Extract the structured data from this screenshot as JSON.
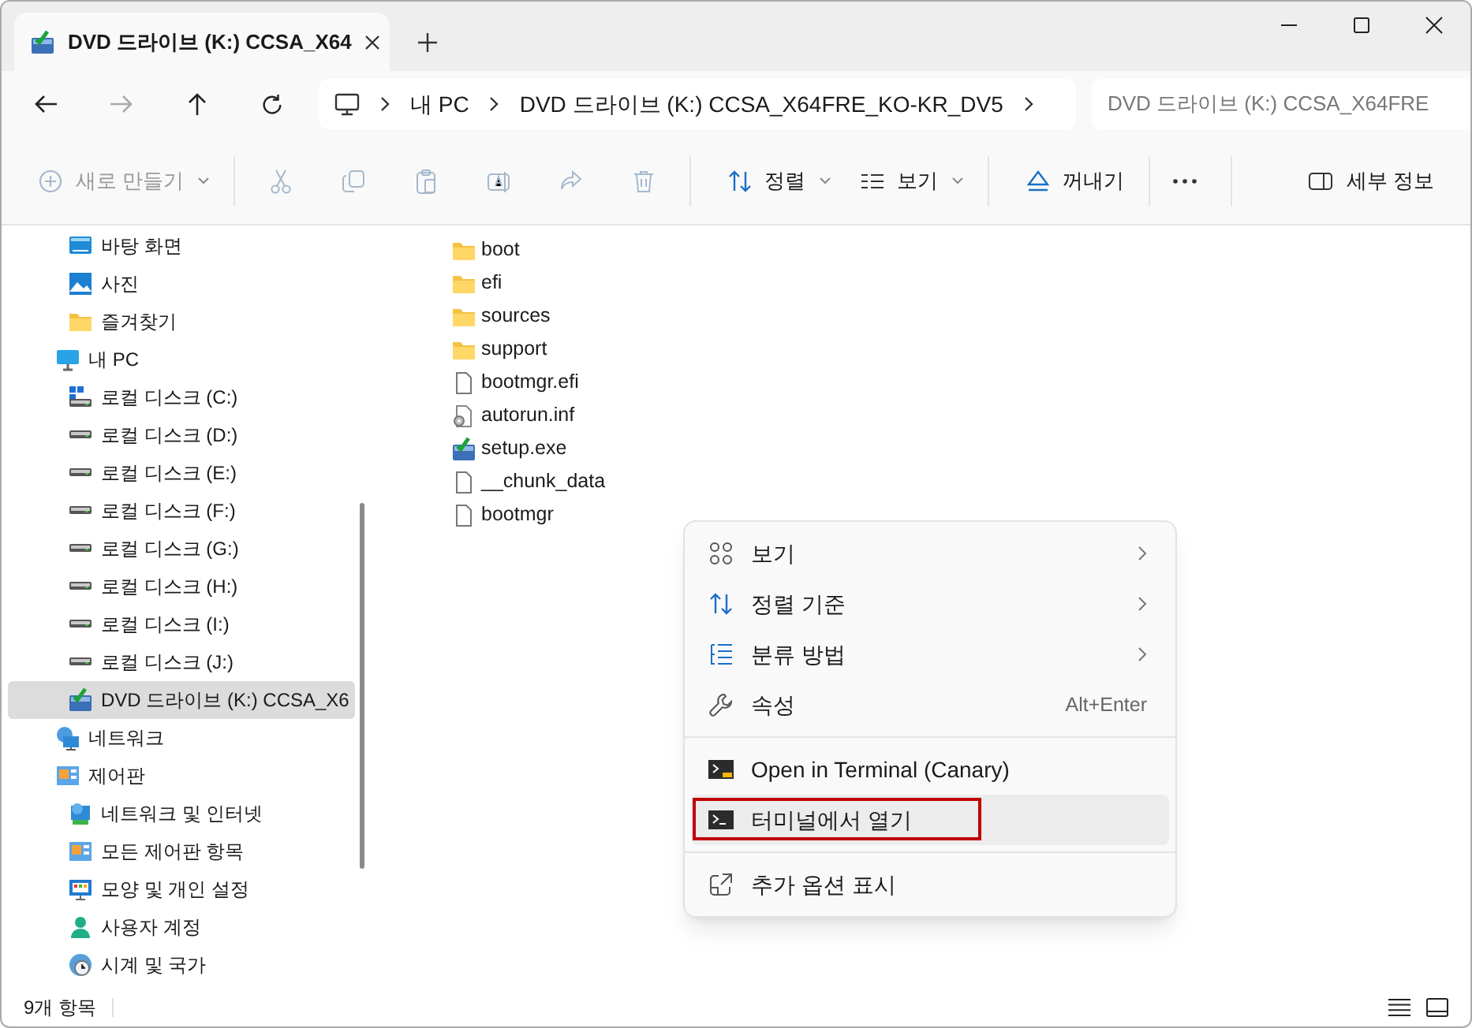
{
  "tab": {
    "title": "DVD 드라이브 (K:) CCSA_X64"
  },
  "address": {
    "segments": [
      "내 PC",
      "DVD 드라이브 (K:) CCSA_X64FRE_KO-KR_DV5"
    ],
    "search_placeholder": "DVD 드라이브 (K:) CCSA_X64FRE"
  },
  "toolbar": [
    {
      "kind": "dropdown",
      "label": "새로 만들기",
      "disabled": true
    },
    {
      "kind": "icon",
      "disabled": true
    },
    {
      "kind": "icon",
      "disabled": true
    },
    {
      "kind": "icon",
      "disabled": true
    },
    {
      "kind": "icon",
      "disabled": true
    },
    {
      "kind": "icon",
      "disabled": true
    },
    {
      "kind": "icon",
      "disabled": true
    },
    {
      "kind": "dropdown",
      "label": "정렬",
      "disabled": false
    },
    {
      "kind": "dropdown",
      "label": "보기",
      "disabled": false
    },
    {
      "kind": "button",
      "label": "꺼내기",
      "disabled": false
    },
    {
      "kind": "icon",
      "disabled": false
    },
    {
      "kind": "button",
      "label": "세부 정보",
      "disabled": false
    }
  ],
  "sidebar": {
    "pinned": [
      {
        "label": "바탕 화면",
        "selected": false
      },
      {
        "label": "사진",
        "selected": false
      },
      {
        "label": "즐겨찾기",
        "selected": false
      }
    ],
    "tree": [
      {
        "label": "내 PC",
        "selected": false,
        "children": [
          {
            "label": "로컬 디스크 (C:)",
            "selected": false
          },
          {
            "label": "로컬 디스크 (D:)",
            "selected": false
          },
          {
            "label": "로컬 디스크 (E:)",
            "selected": false
          },
          {
            "label": "로컬 디스크 (F:)",
            "selected": false
          },
          {
            "label": "로컬 디스크 (G:)",
            "selected": false
          },
          {
            "label": "로컬 디스크 (H:)",
            "selected": false
          },
          {
            "label": "로컬 디스크 (I:)",
            "selected": false
          },
          {
            "label": "로컬 디스크 (J:)",
            "selected": false
          },
          {
            "label": "DVD 드라이브 (K:) CCSA_X6",
            "selected": true
          }
        ]
      },
      {
        "label": "네트워크",
        "selected": false
      },
      {
        "label": "제어판",
        "selected": false,
        "children": [
          {
            "label": "네트워크 및 인터넷",
            "selected": false
          },
          {
            "label": "모든 제어판 항목",
            "selected": false
          },
          {
            "label": "모양 및 개인 설정",
            "selected": false
          },
          {
            "label": "사용자 계정",
            "selected": false
          },
          {
            "label": "시계 및 국가",
            "selected": false
          }
        ]
      }
    ]
  },
  "files": [
    {
      "name": "boot",
      "kind": "folder"
    },
    {
      "name": "efi",
      "kind": "folder"
    },
    {
      "name": "sources",
      "kind": "folder"
    },
    {
      "name": "support",
      "kind": "folder"
    },
    {
      "name": "bootmgr.efi",
      "kind": "file"
    },
    {
      "name": "autorun.inf",
      "kind": "settings"
    },
    {
      "name": "setup.exe",
      "kind": "setup"
    },
    {
      "name": "__chunk_data",
      "kind": "file"
    },
    {
      "name": "bootmgr",
      "kind": "file"
    }
  ],
  "context_menu": [
    {
      "kind": "item",
      "label": "보기",
      "submenu": true,
      "selected": false
    },
    {
      "kind": "item",
      "label": "정렬 기준",
      "submenu": true,
      "selected": false
    },
    {
      "kind": "item",
      "label": "분류 방법",
      "submenu": true,
      "selected": false
    },
    {
      "kind": "item",
      "label": "속성",
      "shortcut": "Alt+Enter",
      "submenu": false,
      "selected": false
    },
    {
      "kind": "separator"
    },
    {
      "kind": "item",
      "label": "Open in Terminal (Canary)",
      "submenu": false,
      "selected": false
    },
    {
      "kind": "item",
      "label": "터미널에서 열기",
      "submenu": false,
      "selected": true
    },
    {
      "kind": "separator"
    },
    {
      "kind": "item",
      "label": "추가 옵션 표시",
      "submenu": false,
      "selected": false
    }
  ],
  "status_bar": {
    "item_count": "9개 항목"
  }
}
